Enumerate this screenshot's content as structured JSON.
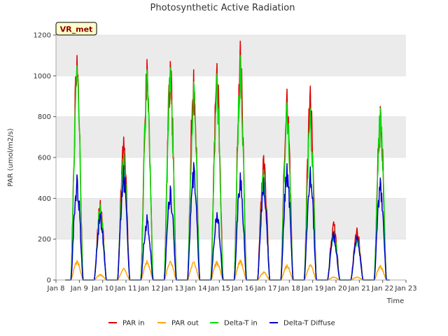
{
  "chart_data": {
    "type": "line",
    "title": "Photosynthetic Active Radiation",
    "xlabel": "Time",
    "ylabel": "PAR (umol/m2/s)",
    "site_label": "VR_met",
    "xlim": [
      8,
      23
    ],
    "ylim": [
      0,
      1200
    ],
    "x_ticks": [
      {
        "v": 8,
        "label": "Jan 8"
      },
      {
        "v": 9,
        "label": "Jan 9"
      },
      {
        "v": 10,
        "label": "Jan 10"
      },
      {
        "v": 11,
        "label": "Jan 11"
      },
      {
        "v": 12,
        "label": "Jan 12"
      },
      {
        "v": 13,
        "label": "Jan 13"
      },
      {
        "v": 14,
        "label": "Jan 14"
      },
      {
        "v": 15,
        "label": "Jan 15"
      },
      {
        "v": 16,
        "label": "Jan 16"
      },
      {
        "v": 17,
        "label": "Jan 17"
      },
      {
        "v": 18,
        "label": "Jan 18"
      },
      {
        "v": 19,
        "label": "Jan 19"
      },
      {
        "v": 20,
        "label": "Jan 20"
      },
      {
        "v": 21,
        "label": "Jan 21"
      },
      {
        "v": 22,
        "label": "Jan 22"
      },
      {
        "v": 23,
        "label": "Jan 23"
      }
    ],
    "y_ticks": [
      0,
      200,
      400,
      600,
      800,
      1000,
      1200
    ],
    "grid": "horizontal bands",
    "legend_position": "bottom",
    "series": [
      {
        "name": "PAR in",
        "color": "#dd0000",
        "stroke_width": 1.5,
        "days": [
          {
            "day": 8.9,
            "peak": 1100
          },
          {
            "day": 9.9,
            "peak": 390
          },
          {
            "day": 10.9,
            "peak": 700
          },
          {
            "day": 11.9,
            "peak": 1080
          },
          {
            "day": 12.9,
            "peak": 1070
          },
          {
            "day": 13.9,
            "peak": 1030
          },
          {
            "day": 14.9,
            "peak": 1060
          },
          {
            "day": 15.9,
            "peak": 1170
          },
          {
            "day": 16.9,
            "peak": 610
          },
          {
            "day": 17.9,
            "peak": 935
          },
          {
            "day": 18.9,
            "peak": 950
          },
          {
            "day": 19.9,
            "peak": 285
          },
          {
            "day": 20.9,
            "peak": 255
          },
          {
            "day": 21.9,
            "peak": 850
          }
        ]
      },
      {
        "name": "PAR out",
        "color": "#ffa500",
        "stroke_width": 1.5,
        "days": [
          {
            "day": 8.9,
            "peak": 95
          },
          {
            "day": 9.9,
            "peak": 28
          },
          {
            "day": 10.9,
            "peak": 58
          },
          {
            "day": 11.9,
            "peak": 95
          },
          {
            "day": 12.9,
            "peak": 92
          },
          {
            "day": 13.9,
            "peak": 88
          },
          {
            "day": 14.9,
            "peak": 92
          },
          {
            "day": 15.9,
            "peak": 98
          },
          {
            "day": 16.9,
            "peak": 40
          },
          {
            "day": 17.9,
            "peak": 75
          },
          {
            "day": 18.9,
            "peak": 75
          },
          {
            "day": 19.9,
            "peak": 15
          },
          {
            "day": 20.9,
            "peak": 15
          },
          {
            "day": 21.9,
            "peak": 72
          }
        ]
      },
      {
        "name": "Delta-T in",
        "color": "#00dd00",
        "stroke_width": 1.5,
        "days": [
          {
            "day": 8.9,
            "peak": 1050
          },
          {
            "day": 9.9,
            "peak": 370
          },
          {
            "day": 10.9,
            "peak": 620
          },
          {
            "day": 11.9,
            "peak": 1030
          },
          {
            "day": 12.9,
            "peak": 1040
          },
          {
            "day": 13.9,
            "peak": 970
          },
          {
            "day": 14.9,
            "peak": 1010
          },
          {
            "day": 15.9,
            "peak": 1100
          },
          {
            "day": 16.9,
            "peak": 540
          },
          {
            "day": 17.9,
            "peak": 870
          },
          {
            "day": 18.9,
            "peak": 840
          },
          {
            "day": 19.9,
            "peak": 240
          },
          {
            "day": 20.9,
            "peak": 215
          },
          {
            "day": 21.9,
            "peak": 840
          }
        ]
      },
      {
        "name": "Delta-T Diffuse",
        "color": "#0000cc",
        "stroke_width": 1.5,
        "days": [
          {
            "day": 8.9,
            "peak": 515
          },
          {
            "day": 9.9,
            "peak": 325
          },
          {
            "day": 10.9,
            "peak": 560
          },
          {
            "day": 11.9,
            "peak": 320
          },
          {
            "day": 12.9,
            "peak": 460
          },
          {
            "day": 13.9,
            "peak": 575
          },
          {
            "day": 14.9,
            "peak": 330
          },
          {
            "day": 15.9,
            "peak": 525
          },
          {
            "day": 16.9,
            "peak": 500
          },
          {
            "day": 17.9,
            "peak": 570
          },
          {
            "day": 18.9,
            "peak": 555
          },
          {
            "day": 19.9,
            "peak": 235
          },
          {
            "day": 20.9,
            "peak": 215
          },
          {
            "day": 21.9,
            "peak": 500
          }
        ]
      }
    ]
  }
}
